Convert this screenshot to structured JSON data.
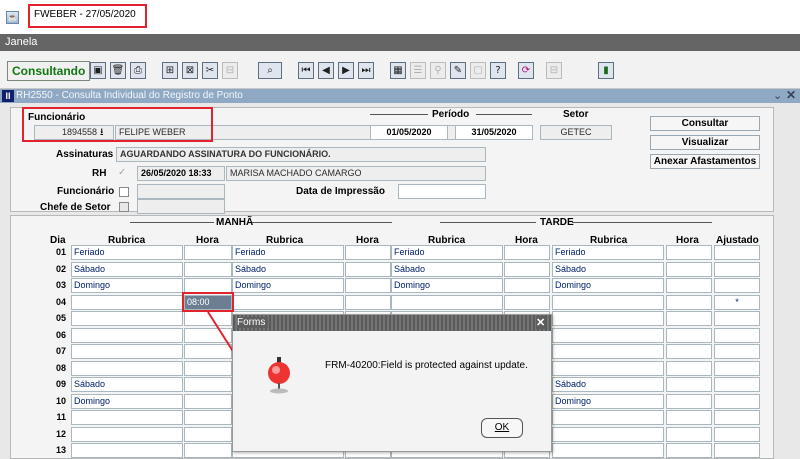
{
  "window": {
    "title": "FWEBER - 27/05/2020"
  },
  "menu": {
    "janela": "Janela"
  },
  "toolbar": {
    "status": "Consultando",
    "icons": [
      "save-icon",
      "delete-icon",
      "print-icon",
      "insert-record-icon",
      "delete-record-icon",
      "cut-icon",
      "disabled-icon",
      "query-icon",
      "first-record-icon",
      "previous-record-icon",
      "next-record-icon",
      "last-record-icon",
      "calendar-icon",
      "list-icon",
      "search-icon",
      "edit-icon",
      "disabled-icon",
      "help-icon",
      "refresh-icon",
      "disabled-icon",
      "exit-icon"
    ]
  },
  "form": {
    "title": "RH2550 - Consulta Individual do Registro de Ponto"
  },
  "header": {
    "funcionario_label": "Funcionário",
    "funcionario_id": "1894558",
    "funcionario_name": "FELIPE WEBER",
    "periodo_label": "Período",
    "periodo_start": "01/05/2020",
    "periodo_end": "31/05/2020",
    "setor_label": "Setor",
    "setor_value": "GETEC",
    "assinaturas_label": "Assinaturas",
    "assinaturas_value": "AGUARDANDO ASSINATURA DO FUNCIONÁRIO.",
    "rh_label": "RH",
    "rh_datetime": "26/05/2020 18:33",
    "rh_name": "MARISA MACHADO CAMARGO",
    "func_label": "Funcionário",
    "data_impressao_label": "Data de Impressão",
    "chefe_label": "Chefe de Setor"
  },
  "buttons": {
    "consultar": "Consultar",
    "visualizar": "Visualizar",
    "anexar": "Anexar Afastamentos"
  },
  "grid": {
    "manha": "MANHÃ",
    "tarde": "TARDE",
    "columns": {
      "dia": "Dia",
      "rubrica": "Rubrica",
      "hora": "Hora",
      "ajustado": "Ajustado"
    },
    "rows": [
      {
        "dia": "01",
        "m1": "Feriado",
        "h1": "",
        "m2": "Feriado",
        "h2": "",
        "t1": "Feriado",
        "h3": "",
        "t2": "Feriado",
        "h4": "",
        "aj": ""
      },
      {
        "dia": "02",
        "m1": "Sábado",
        "h1": "",
        "m2": "Sábado",
        "h2": "",
        "t1": "Sábado",
        "h3": "",
        "t2": "Sábado",
        "h4": "",
        "aj": ""
      },
      {
        "dia": "03",
        "m1": "Domingo",
        "h1": "",
        "m2": "Domingo",
        "h2": "",
        "t1": "Domingo",
        "h3": "",
        "t2": "Domingo",
        "h4": "",
        "aj": ""
      },
      {
        "dia": "04",
        "m1": "",
        "h1": "08:00",
        "m2": "",
        "h2": "",
        "t1": "",
        "h3": "",
        "t2": "",
        "h4": "",
        "aj": "*"
      },
      {
        "dia": "05",
        "m1": "",
        "h1": "",
        "m2": "",
        "h2": "",
        "t1": "",
        "h3": "",
        "t2": "",
        "h4": "",
        "aj": ""
      },
      {
        "dia": "06",
        "m1": "",
        "h1": "",
        "m2": "",
        "h2": "",
        "t1": "",
        "h3": "",
        "t2": "",
        "h4": "",
        "aj": ""
      },
      {
        "dia": "07",
        "m1": "",
        "h1": "",
        "m2": "",
        "h2": "",
        "t1": "",
        "h3": "",
        "t2": "",
        "h4": "",
        "aj": ""
      },
      {
        "dia": "08",
        "m1": "",
        "h1": "",
        "m2": "",
        "h2": "",
        "t1": "",
        "h3": "",
        "t2": "",
        "h4": "",
        "aj": ""
      },
      {
        "dia": "09",
        "m1": "Sábado",
        "h1": "",
        "m2": "",
        "h2": "",
        "t1": "",
        "h3": "",
        "t2": "Sábado",
        "h4": "",
        "aj": ""
      },
      {
        "dia": "10",
        "m1": "Domingo",
        "h1": "",
        "m2": "",
        "h2": "",
        "t1": "",
        "h3": "",
        "t2": "Domingo",
        "h4": "",
        "aj": ""
      },
      {
        "dia": "11",
        "m1": "",
        "h1": "",
        "m2": "",
        "h2": "",
        "t1": "",
        "h3": "",
        "t2": "",
        "h4": "",
        "aj": ""
      },
      {
        "dia": "12",
        "m1": "",
        "h1": "",
        "m2": "",
        "h2": "",
        "t1": "",
        "h3": "",
        "t2": "",
        "h4": "",
        "aj": ""
      },
      {
        "dia": "13",
        "m1": "",
        "h1": "",
        "m2": "",
        "h2": "",
        "t1": "",
        "h3": "",
        "t2": "",
        "h4": "",
        "aj": ""
      }
    ]
  },
  "dialog": {
    "title": "Forms",
    "message": "FRM-40200:Field is protected against update.",
    "ok": "OK",
    "icon": "alarm-bell-icon"
  },
  "colors": {
    "highlight": "#e0232f",
    "menubar": "#656565",
    "form_title": "#8fa9c4"
  }
}
